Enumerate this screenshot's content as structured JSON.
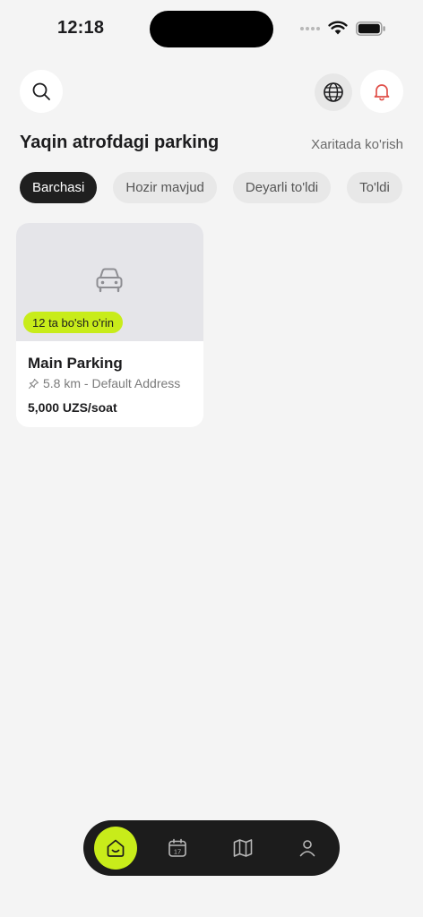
{
  "status_bar": {
    "time": "12:18"
  },
  "header": {
    "search_icon": "search-icon",
    "language_icon": "globe-icon",
    "notification_icon": "bell-icon"
  },
  "section": {
    "title": "Yaqin atrofdagi parking",
    "map_link": "Xaritada ko'rish"
  },
  "filters": [
    {
      "label": "Barchasi",
      "active": true
    },
    {
      "label": "Hozir mavjud",
      "active": false
    },
    {
      "label": "Deyarli to'ldi",
      "active": false
    },
    {
      "label": "To'ldi",
      "active": false
    }
  ],
  "parkings": [
    {
      "name": "Main Parking",
      "free_spots": "12 ta bo'sh o'rin",
      "distance": "5.8 km - Default Address",
      "price": "5,000 UZS/soat"
    }
  ],
  "bottom_nav": {
    "items": [
      "home-icon",
      "calendar-icon",
      "map-icon",
      "profile-icon"
    ],
    "calendar_day": "17"
  },
  "colors": {
    "accent": "#c8ec1a",
    "dark": "#1c1c1c",
    "background": "#f4f4f4",
    "bell": "#e0504a"
  }
}
